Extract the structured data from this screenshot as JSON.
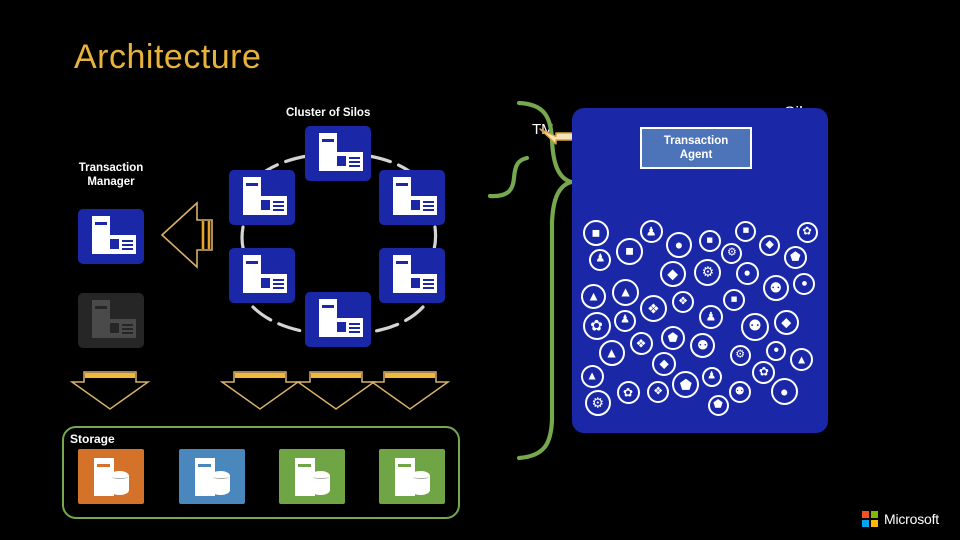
{
  "slide": {
    "title": "Architecture",
    "title_color": "#e8b33c",
    "background": "#000000"
  },
  "labels": {
    "cluster_of_silos": "Cluster of Silos",
    "transaction_manager": "Transaction\nManager",
    "transaction_manager_line1": "Transaction",
    "transaction_manager_line2": "Manager",
    "tm": "TM",
    "silo": "Silo",
    "storage": "Storage",
    "transaction_agent_line1": "Transaction",
    "transaction_agent_line2": "Agent"
  },
  "colors": {
    "server_tile": "#1a28a8",
    "server_tile_dim": "#262626",
    "silo_panel": "#1a28a8",
    "agent_box": "#4d74b8",
    "accent_gold": "#e8b33c",
    "arrow_fill": "#f5e2bb",
    "bracket_green": "#76a84f",
    "connector_gray": "#d4d4d4",
    "storage_orange": "#d4722a",
    "storage_blue": "#4a87bd",
    "storage_green": "#6fa544",
    "text_white": "#ffffff"
  },
  "transaction_manager": {
    "servers": [
      {
        "id": "tm-primary",
        "state": "active"
      },
      {
        "id": "tm-standby",
        "state": "dimmed"
      }
    ]
  },
  "cluster": {
    "count": 6,
    "servers": [
      {
        "id": "silo-n",
        "position": "top"
      },
      {
        "id": "silo-ne",
        "position": "top-right"
      },
      {
        "id": "silo-se",
        "position": "bottom-right"
      },
      {
        "id": "silo-s",
        "position": "bottom"
      },
      {
        "id": "silo-sw",
        "position": "bottom-left"
      },
      {
        "id": "silo-nw",
        "position": "top-left"
      }
    ]
  },
  "storage": {
    "items": [
      {
        "id": "storage-1",
        "color": "#d4722a"
      },
      {
        "id": "storage-2",
        "color": "#4a87bd"
      },
      {
        "id": "storage-3",
        "color": "#6fa544"
      },
      {
        "id": "storage-4",
        "color": "#6fa544"
      }
    ]
  },
  "down_arrows": {
    "count": 4
  },
  "silo": {
    "agent_fanout_arrows": 5,
    "grain_count": 52,
    "grain_glyphs": [
      "♟",
      "■",
      "●",
      "▲",
      "⬟",
      "⚉",
      "✿",
      "❖",
      "◆",
      "⚙"
    ]
  },
  "brand": {
    "name": "Microsoft",
    "tiles": [
      "#f25022",
      "#7fba00",
      "#00a4ef",
      "#ffb900"
    ]
  }
}
